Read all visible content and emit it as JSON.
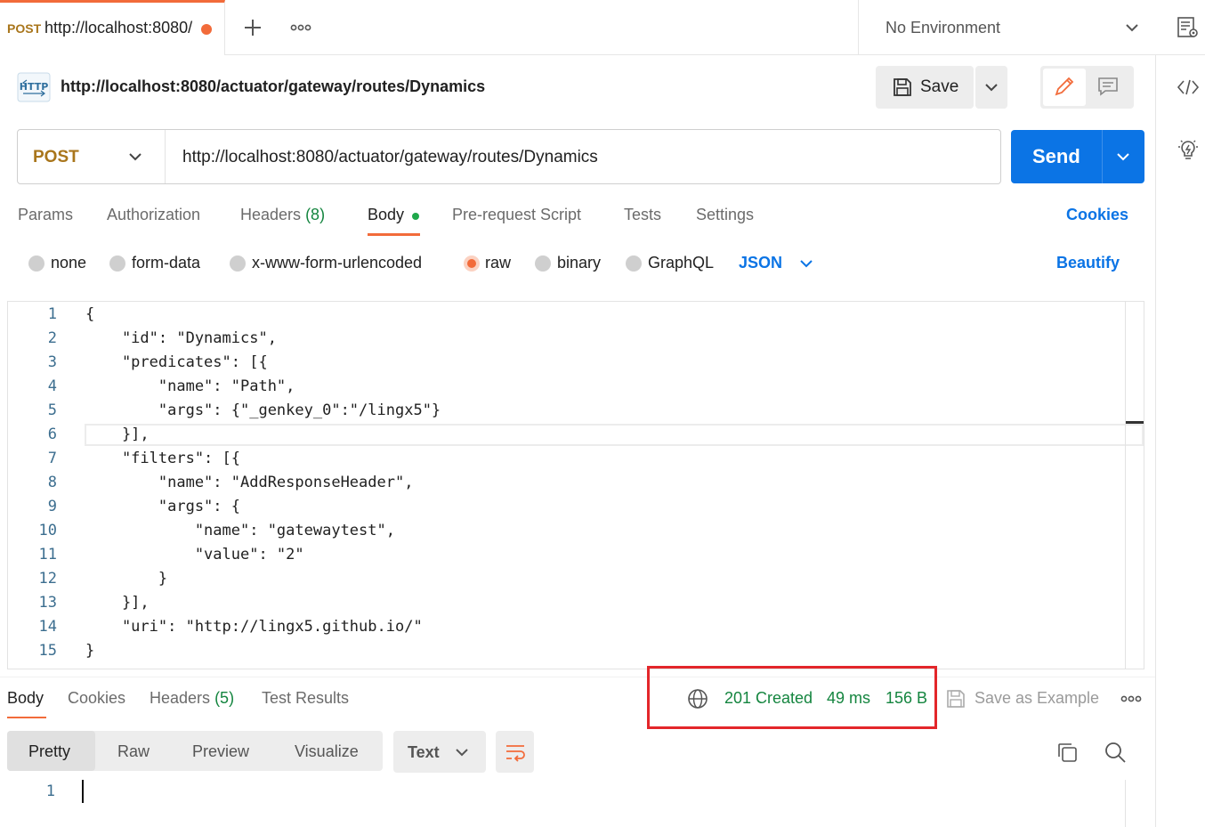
{
  "tab": {
    "method": "POST",
    "url": "http://localhost:8080/"
  },
  "environment": {
    "label": "No Environment"
  },
  "request": {
    "title": "http://localhost:8080/actuator/gateway/routes/Dynamics",
    "method": "POST",
    "url": "http://localhost:8080/actuator/gateway/routes/Dynamics",
    "save_label": "Save",
    "send_label": "Send"
  },
  "request_tabs": [
    {
      "label": "Params"
    },
    {
      "label": "Authorization"
    },
    {
      "label": "Headers",
      "count": "(8)"
    },
    {
      "label": "Body"
    },
    {
      "label": "Pre-request Script"
    },
    {
      "label": "Tests"
    },
    {
      "label": "Settings"
    }
  ],
  "cookies_label": "Cookies",
  "body_types": [
    {
      "label": "none"
    },
    {
      "label": "form-data"
    },
    {
      "label": "x-www-form-urlencoded"
    },
    {
      "label": "raw"
    },
    {
      "label": "binary"
    },
    {
      "label": "GraphQL"
    }
  ],
  "body_format": "JSON",
  "beautify_label": "Beautify",
  "editor": {
    "line_numbers": [
      "1",
      "2",
      "3",
      "4",
      "5",
      "6",
      "7",
      "8",
      "9",
      "10",
      "11",
      "12",
      "13",
      "14",
      "15"
    ],
    "lines": [
      "{",
      "    \"id\": \"Dynamics\",",
      "    \"predicates\": [{",
      "        \"name\": \"Path\",",
      "        \"args\": {\"_genkey_0\":\"/lingx5\"}",
      "    }],",
      "    \"filters\": [{",
      "        \"name\": \"AddResponseHeader\",",
      "        \"args\": {",
      "            \"name\": \"gatewaytest\",",
      "            \"value\": \"2\"",
      "        }",
      "    }],",
      "    \"uri\": \"http://lingx5.github.io/\"",
      "}"
    ]
  },
  "response_tabs": [
    {
      "label": "Body"
    },
    {
      "label": "Cookies"
    },
    {
      "label": "Headers",
      "count": "(5)"
    },
    {
      "label": "Test Results"
    }
  ],
  "response_status": {
    "status": "201 Created",
    "time": "49 ms",
    "size": "156 B"
  },
  "save_example_label": "Save as Example",
  "response_formats": [
    {
      "label": "Pretty"
    },
    {
      "label": "Raw"
    },
    {
      "label": "Preview"
    },
    {
      "label": "Visualize"
    }
  ],
  "response_text_format": "Text",
  "response_line_numbers": [
    "1"
  ],
  "colors": {
    "accent": "#f26b3a",
    "primary": "#0b74e5",
    "success": "#14853f",
    "method_post": "#a9761c",
    "highlight": "#e3262a"
  }
}
